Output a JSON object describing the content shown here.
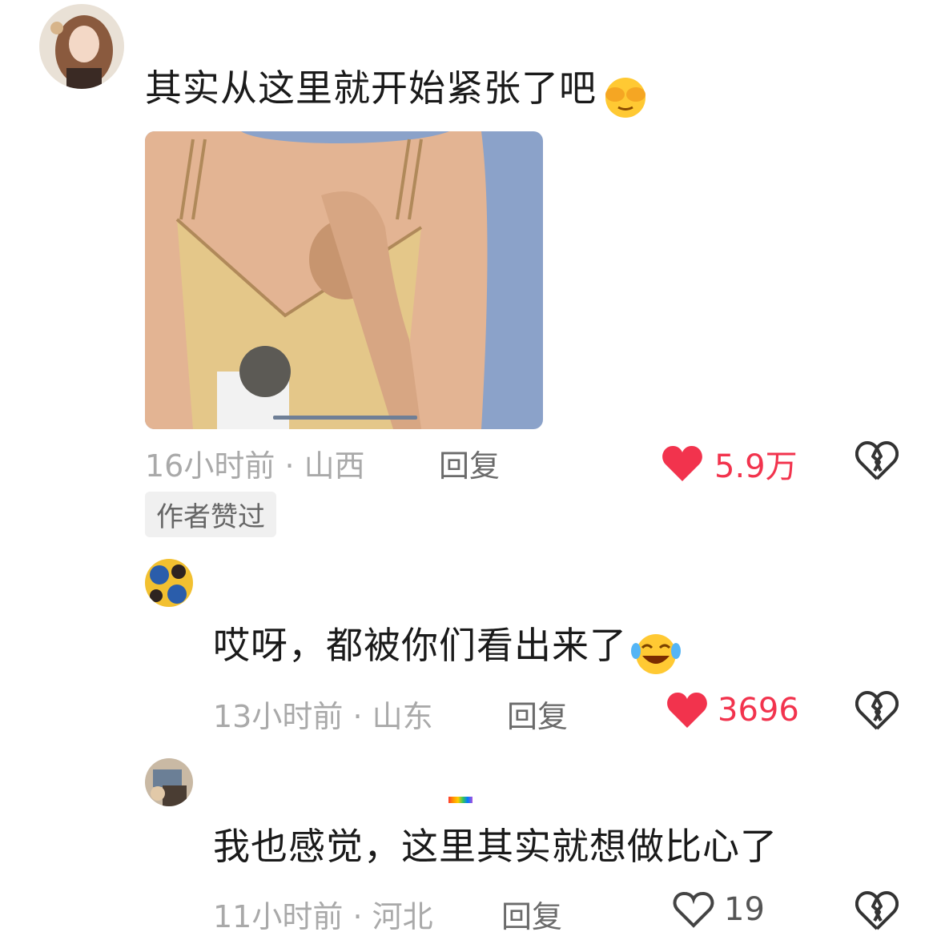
{
  "comments": [
    {
      "text": "其实从这里就开始紧张了吧",
      "emoji": "hiding-face-emoji",
      "time": "16小时前",
      "location": "山西",
      "reply_label": "回复",
      "likes": "5.9万",
      "liked": true,
      "badge": "作者赞过"
    },
    {
      "text": "哎呀，都被你们看出来了",
      "emoji": "laughing-crying-emoji",
      "time": "13小时前",
      "location": "山东",
      "reply_label": "回复",
      "likes": "3696",
      "liked": true
    },
    {
      "text": "我也感觉，这里其实就想做比心了",
      "time": "11小时前",
      "location": "河北",
      "reply_label": "回复",
      "likes": "19",
      "liked": false
    }
  ],
  "colors": {
    "like_red": "#f2334d",
    "meta_gray": "#a9a9a9"
  }
}
